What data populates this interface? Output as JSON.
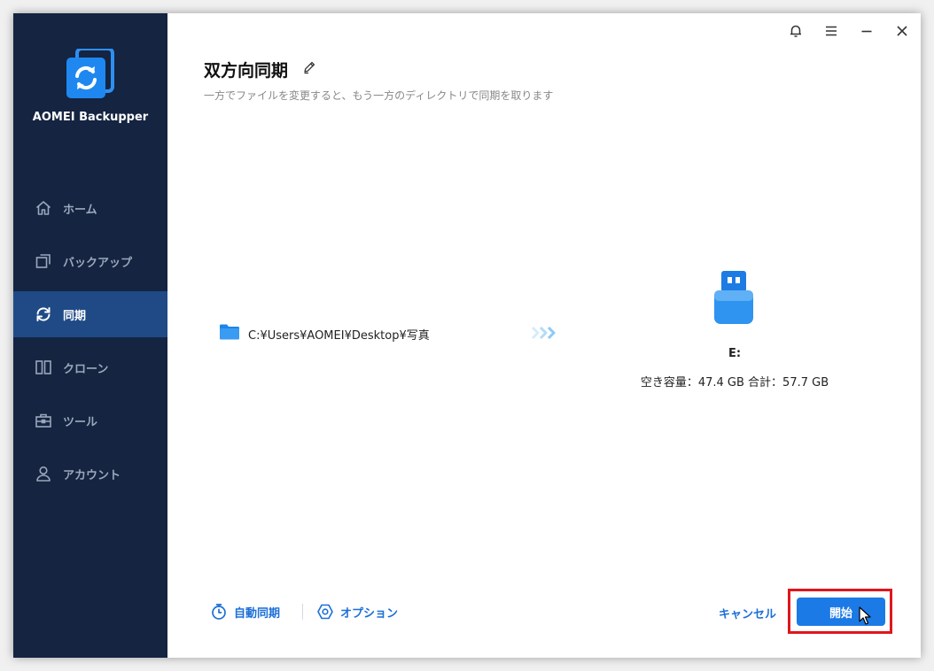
{
  "app": {
    "name": "AOMEI Backupper"
  },
  "sidebar": {
    "items": [
      {
        "label": "ホーム",
        "icon": "home-icon",
        "active": false
      },
      {
        "label": "バックアップ",
        "icon": "backup-icon",
        "active": false
      },
      {
        "label": "同期",
        "icon": "sync-icon",
        "active": true
      },
      {
        "label": "クローン",
        "icon": "clone-icon",
        "active": false
      },
      {
        "label": "ツール",
        "icon": "toolbox-icon",
        "active": false
      },
      {
        "label": "アカウント",
        "icon": "user-icon",
        "active": false
      }
    ]
  },
  "titlebar": {
    "icons": [
      "bell-icon",
      "menu-icon",
      "minimize-icon",
      "close-icon"
    ]
  },
  "page": {
    "title": "双方向同期",
    "subtitle": "一方でファイルを変更すると、もう一方のディレクトリで同期を取ります"
  },
  "source": {
    "path": "C:¥Users¥AOMEI¥Desktop¥写真"
  },
  "destination": {
    "label": "E:",
    "capacity": "空き容量：47.4 GB 合計：57.7 GB"
  },
  "footer": {
    "schedule_label": "自動同期",
    "options_label": "オプション",
    "cancel_label": "キャンセル",
    "start_label": "開始"
  },
  "colors": {
    "sidebar": "#142441",
    "active": "#1f4a86",
    "accent": "#1c7ae6",
    "highlight": "#e0161d"
  }
}
